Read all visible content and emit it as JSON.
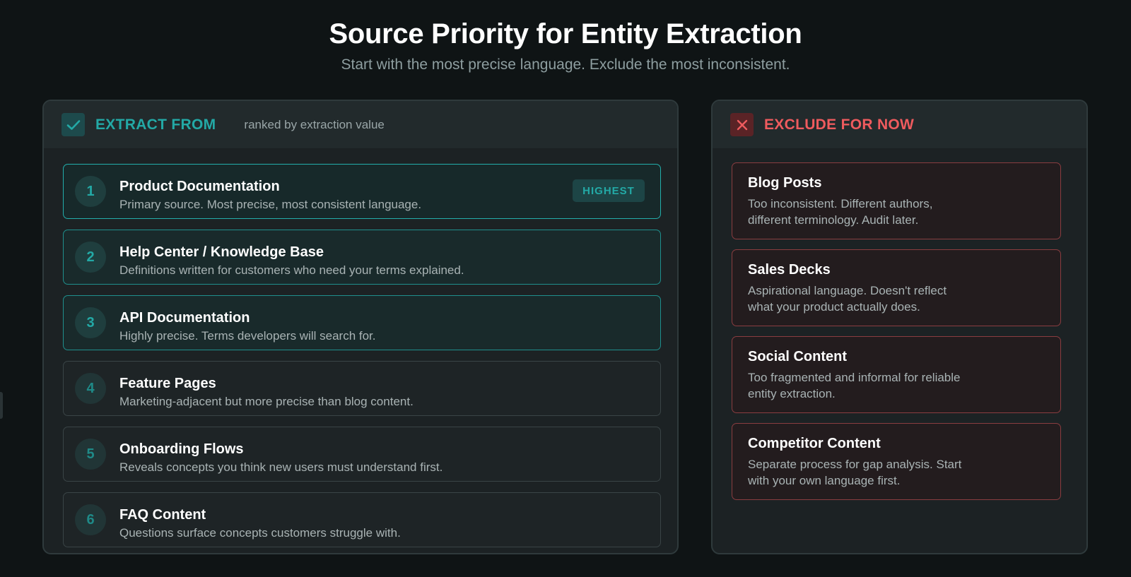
{
  "header": {
    "title": "Source Priority for Entity Extraction",
    "subtitle": "Start with the most precise language. Exclude the most inconsistent."
  },
  "extract": {
    "label": "EXTRACT FROM",
    "note": "ranked by extraction value",
    "icon": "check-icon",
    "accent": "#23a9a6",
    "items": [
      {
        "rank": "1",
        "title": "Product Documentation",
        "desc": "Primary source. Most precise, most consistent language.",
        "badge": "HIGHEST"
      },
      {
        "rank": "2",
        "title": "Help Center / Knowledge Base",
        "desc": "Definitions written for customers who need your terms explained."
      },
      {
        "rank": "3",
        "title": "API Documentation",
        "desc": "Highly precise. Terms developers will search for."
      },
      {
        "rank": "4",
        "title": "Feature Pages",
        "desc": "Marketing-adjacent but more precise than blog content."
      },
      {
        "rank": "5",
        "title": "Onboarding Flows",
        "desc": "Reveals concepts you think new users must understand first."
      },
      {
        "rank": "6",
        "title": "FAQ Content",
        "desc": "Questions surface concepts customers struggle with."
      }
    ]
  },
  "exclude": {
    "label": "EXCLUDE FOR NOW",
    "icon": "cross-icon",
    "accent": "#ef5b5e",
    "items": [
      {
        "title": "Blog Posts",
        "desc": "Too inconsistent. Different authors, different terminology. Audit later."
      },
      {
        "title": "Sales Decks",
        "desc": "Aspirational language. Doesn't reflect what your product actually does."
      },
      {
        "title": "Social Content",
        "desc": "Too fragmented and informal for reliable entity extraction."
      },
      {
        "title": "Competitor Content",
        "desc": "Separate process for gap analysis. Start with your own language first."
      }
    ]
  }
}
